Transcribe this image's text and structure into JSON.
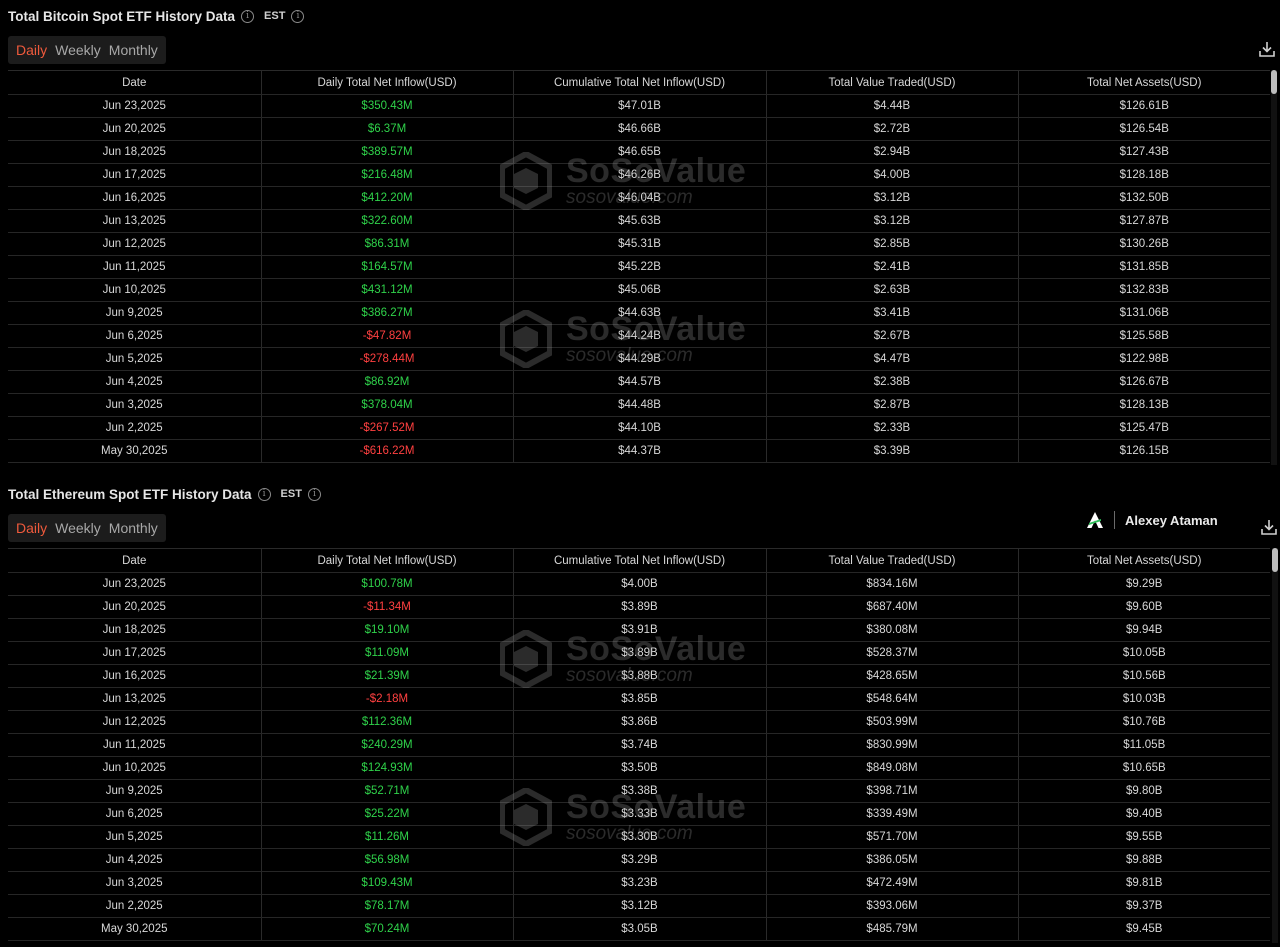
{
  "btc": {
    "title": "Total Bitcoin Spot ETF History Data",
    "timezone": "EST",
    "tabs": [
      "Daily",
      "Weekly",
      "Monthly"
    ],
    "active_tab": "Daily",
    "headers": [
      "Date",
      "Daily Total Net Inflow(USD)",
      "Cumulative Total Net Inflow(USD)",
      "Total Value Traded(USD)",
      "Total Net Assets(USD)"
    ],
    "rows": [
      [
        "Jun 23,2025",
        "$350.43M",
        "$47.01B",
        "$4.44B",
        "$126.61B"
      ],
      [
        "Jun 20,2025",
        "$6.37M",
        "$46.66B",
        "$2.72B",
        "$126.54B"
      ],
      [
        "Jun 18,2025",
        "$389.57M",
        "$46.65B",
        "$2.94B",
        "$127.43B"
      ],
      [
        "Jun 17,2025",
        "$216.48M",
        "$46.26B",
        "$4.00B",
        "$128.18B"
      ],
      [
        "Jun 16,2025",
        "$412.20M",
        "$46.04B",
        "$3.12B",
        "$132.50B"
      ],
      [
        "Jun 13,2025",
        "$322.60M",
        "$45.63B",
        "$3.12B",
        "$127.87B"
      ],
      [
        "Jun 12,2025",
        "$86.31M",
        "$45.31B",
        "$2.85B",
        "$130.26B"
      ],
      [
        "Jun 11,2025",
        "$164.57M",
        "$45.22B",
        "$2.41B",
        "$131.85B"
      ],
      [
        "Jun 10,2025",
        "$431.12M",
        "$45.06B",
        "$2.63B",
        "$132.83B"
      ],
      [
        "Jun 9,2025",
        "$386.27M",
        "$44.63B",
        "$3.41B",
        "$131.06B"
      ],
      [
        "Jun 6,2025",
        "-$47.82M",
        "$44.24B",
        "$2.67B",
        "$125.58B"
      ],
      [
        "Jun 5,2025",
        "-$278.44M",
        "$44.29B",
        "$4.47B",
        "$122.98B"
      ],
      [
        "Jun 4,2025",
        "$86.92M",
        "$44.57B",
        "$2.38B",
        "$126.67B"
      ],
      [
        "Jun 3,2025",
        "$378.04M",
        "$44.48B",
        "$2.87B",
        "$128.13B"
      ],
      [
        "Jun 2,2025",
        "-$267.52M",
        "$44.10B",
        "$2.33B",
        "$125.47B"
      ],
      [
        "May 30,2025",
        "-$616.22M",
        "$44.37B",
        "$3.39B",
        "$126.15B"
      ]
    ]
  },
  "eth": {
    "title": "Total Ethereum Spot ETF History Data",
    "timezone": "EST",
    "tabs": [
      "Daily",
      "Weekly",
      "Monthly"
    ],
    "active_tab": "Daily",
    "headers": [
      "Date",
      "Daily Total Net Inflow(USD)",
      "Cumulative Total Net Inflow(USD)",
      "Total Value Traded(USD)",
      "Total Net Assets(USD)"
    ],
    "rows": [
      [
        "Jun 23,2025",
        "$100.78M",
        "$4.00B",
        "$834.16M",
        "$9.29B"
      ],
      [
        "Jun 20,2025",
        "-$11.34M",
        "$3.89B",
        "$687.40M",
        "$9.60B"
      ],
      [
        "Jun 18,2025",
        "$19.10M",
        "$3.91B",
        "$380.08M",
        "$9.94B"
      ],
      [
        "Jun 17,2025",
        "$11.09M",
        "$3.89B",
        "$528.37M",
        "$10.05B"
      ],
      [
        "Jun 16,2025",
        "$21.39M",
        "$3.88B",
        "$428.65M",
        "$10.56B"
      ],
      [
        "Jun 13,2025",
        "-$2.18M",
        "$3.85B",
        "$548.64M",
        "$10.03B"
      ],
      [
        "Jun 12,2025",
        "$112.36M",
        "$3.86B",
        "$503.99M",
        "$10.76B"
      ],
      [
        "Jun 11,2025",
        "$240.29M",
        "$3.74B",
        "$830.99M",
        "$11.05B"
      ],
      [
        "Jun 10,2025",
        "$124.93M",
        "$3.50B",
        "$849.08M",
        "$10.65B"
      ],
      [
        "Jun 9,2025",
        "$52.71M",
        "$3.38B",
        "$398.71M",
        "$9.80B"
      ],
      [
        "Jun 6,2025",
        "$25.22M",
        "$3.33B",
        "$339.49M",
        "$9.40B"
      ],
      [
        "Jun 5,2025",
        "$11.26M",
        "$3.30B",
        "$571.70M",
        "$9.55B"
      ],
      [
        "Jun 4,2025",
        "$56.98M",
        "$3.29B",
        "$386.05M",
        "$9.88B"
      ],
      [
        "Jun 3,2025",
        "$109.43M",
        "$3.23B",
        "$472.49M",
        "$9.81B"
      ],
      [
        "Jun 2,2025",
        "$78.17M",
        "$3.12B",
        "$393.06M",
        "$9.37B"
      ],
      [
        "May 30,2025",
        "$70.24M",
        "$3.05B",
        "$485.79M",
        "$9.45B"
      ]
    ]
  },
  "brand": {
    "name": "Alexey Ataman"
  },
  "watermark": {
    "name": "SoSoValue",
    "domain": "sosovalue.com"
  },
  "colors": {
    "positive": "#2fd24a",
    "negative": "#ff4040",
    "active_tab": "#ef5a3c",
    "background": "#000000"
  },
  "icons": {
    "info": "info-icon",
    "download": "download-icon",
    "brand_logo": "brand-logo-icon",
    "watermark_logo": "watermark-logo-icon"
  }
}
